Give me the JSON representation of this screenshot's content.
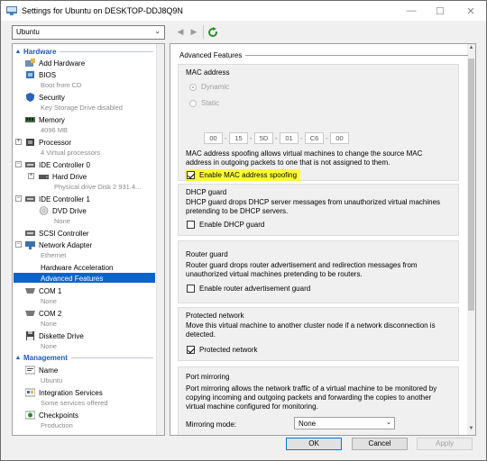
{
  "window": {
    "title": "Settings for Ubuntu on DESKTOP-DDJ8Q9N",
    "minimize": "—",
    "maximize": "☐",
    "close": "✕"
  },
  "toolbar": {
    "vm_selected": "Ubuntu",
    "back": "◀",
    "forward": "▶"
  },
  "tree": {
    "hardware_header": "Hardware",
    "add_hardware": "Add Hardware",
    "bios": "BIOS",
    "bios_sub": "Boot from CD",
    "security": "Security",
    "security_sub": "Key Storage Drive disabled",
    "memory": "Memory",
    "memory_sub": "4096 MB",
    "processor": "Processor",
    "processor_sub": "4 Virtual processors",
    "ide0": "IDE Controller 0",
    "hard_drive": "Hard Drive",
    "hard_drive_sub": "Physical drive Disk 2 931.4...",
    "ide1": "IDE Controller 1",
    "dvd": "DVD Drive",
    "dvd_sub": "None",
    "scsi": "SCSI Controller",
    "network": "Network Adapter",
    "network_sub": "Ethernet",
    "hw_accel": "Hardware Acceleration",
    "adv_features": "Advanced Features",
    "com1": "COM 1",
    "com1_sub": "None",
    "com2": "COM 2",
    "com2_sub": "None",
    "diskette": "Diskette Drive",
    "diskette_sub": "None",
    "management_header": "Management",
    "name": "Name",
    "name_sub": "Ubuntu",
    "integration": "Integration Services",
    "integration_sub": "Some services offered",
    "checkpoints": "Checkpoints",
    "checkpoints_sub": "Production"
  },
  "panel": {
    "header": "Advanced Features",
    "mac": {
      "title": "MAC address",
      "dynamic": "Dynamic",
      "static": "Static",
      "octets": [
        "00",
        "15",
        "5D",
        "01",
        "C6",
        "00"
      ],
      "description": "MAC address spoofing allows virtual machines to change the source MAC address in outgoing packets to one that is not assigned to them.",
      "spoofing_label": "Enable MAC address spoofing",
      "spoofing_checked": true
    },
    "dhcp": {
      "title": "DHCP guard",
      "description": "DHCP guard drops DHCP server messages from unauthorized virtual machines pretending to be DHCP servers.",
      "label": "Enable DHCP guard",
      "checked": false
    },
    "router": {
      "title": "Router guard",
      "description": "Router guard drops router advertisement and redirection messages from unauthorized virtual machines pretending to be routers.",
      "label": "Enable router advertisement guard",
      "checked": false
    },
    "protected": {
      "title": "Protected network",
      "description": "Move this virtual machine to another cluster node if a network disconnection is detected.",
      "label": "Protected network",
      "checked": true
    },
    "mirroring": {
      "title": "Port mirroring",
      "description": "Port mirroring allows the network traffic of a virtual machine to be monitored by copying incoming and outgoing packets and forwarding the copies to another virtual machine configured for monitoring.",
      "mode_label": "Mirroring mode:",
      "mode_value": "None"
    }
  },
  "buttons": {
    "ok": "OK",
    "cancel": "Cancel",
    "apply": "Apply"
  },
  "colors": {
    "accent": "#0a64c8",
    "section_header": "#1e5eb0",
    "highlight": "#ffff33"
  }
}
